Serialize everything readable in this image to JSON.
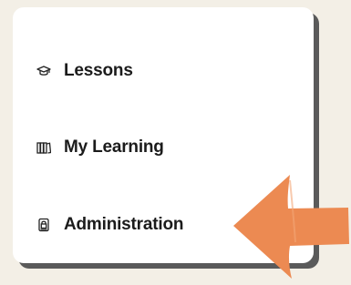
{
  "menu": {
    "items": [
      {
        "label": "Lessons",
        "icon": "graduation-cap-icon"
      },
      {
        "label": "My Learning",
        "icon": "books-icon"
      },
      {
        "label": "Administration",
        "icon": "badge-lock-icon"
      }
    ]
  },
  "annotation": {
    "arrow_color": "#ec8a52",
    "points_to": "Administration"
  },
  "colors": {
    "background": "#f3efe6",
    "card": "#ffffff",
    "card_shadow": "#5a5a5a",
    "text": "#1b1b1b"
  }
}
